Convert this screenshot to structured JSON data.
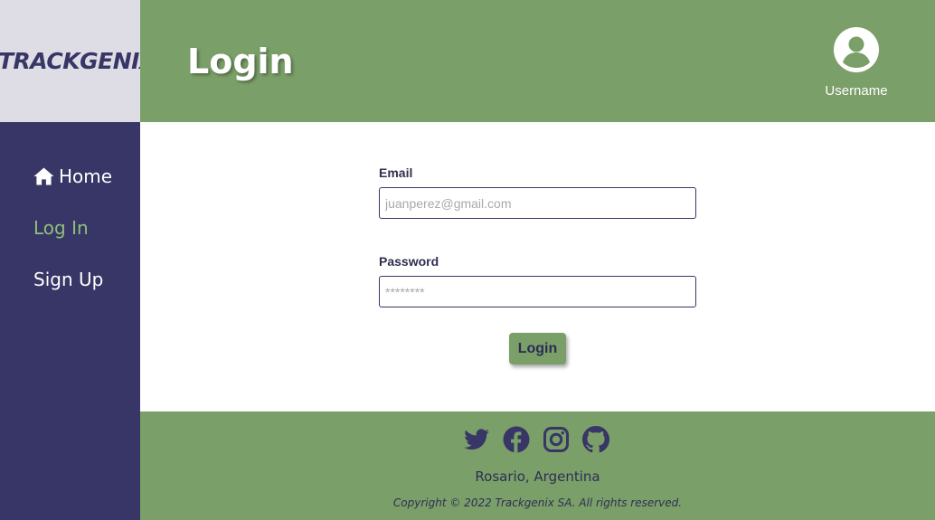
{
  "brand": {
    "logo_text": "TRACKGENIX"
  },
  "header": {
    "title": "Login",
    "username": "Username"
  },
  "sidebar": {
    "items": [
      {
        "label": "Home",
        "icon": "home-icon"
      },
      {
        "label": "Log In",
        "active": true
      },
      {
        "label": "Sign Up"
      }
    ]
  },
  "form": {
    "email_label": "Email",
    "email_value": "",
    "email_placeholder": "juanperez@gmail.com",
    "password_label": "Password",
    "password_value": "",
    "password_placeholder": "********",
    "submit_label": "Login"
  },
  "footer": {
    "social_icons": [
      "twitter-icon",
      "facebook-icon",
      "instagram-icon",
      "github-icon"
    ],
    "location": "Rosario, Argentina",
    "copyright": "Copyright © 2022 Trackgenix SA. All rights reserved."
  },
  "colors": {
    "primary_green": "#7a9f68",
    "sidebar_navy": "#373666",
    "logo_bg": "#dedde6",
    "active_nav": "#8fbf7c",
    "text_dark": "#2f2f55"
  }
}
